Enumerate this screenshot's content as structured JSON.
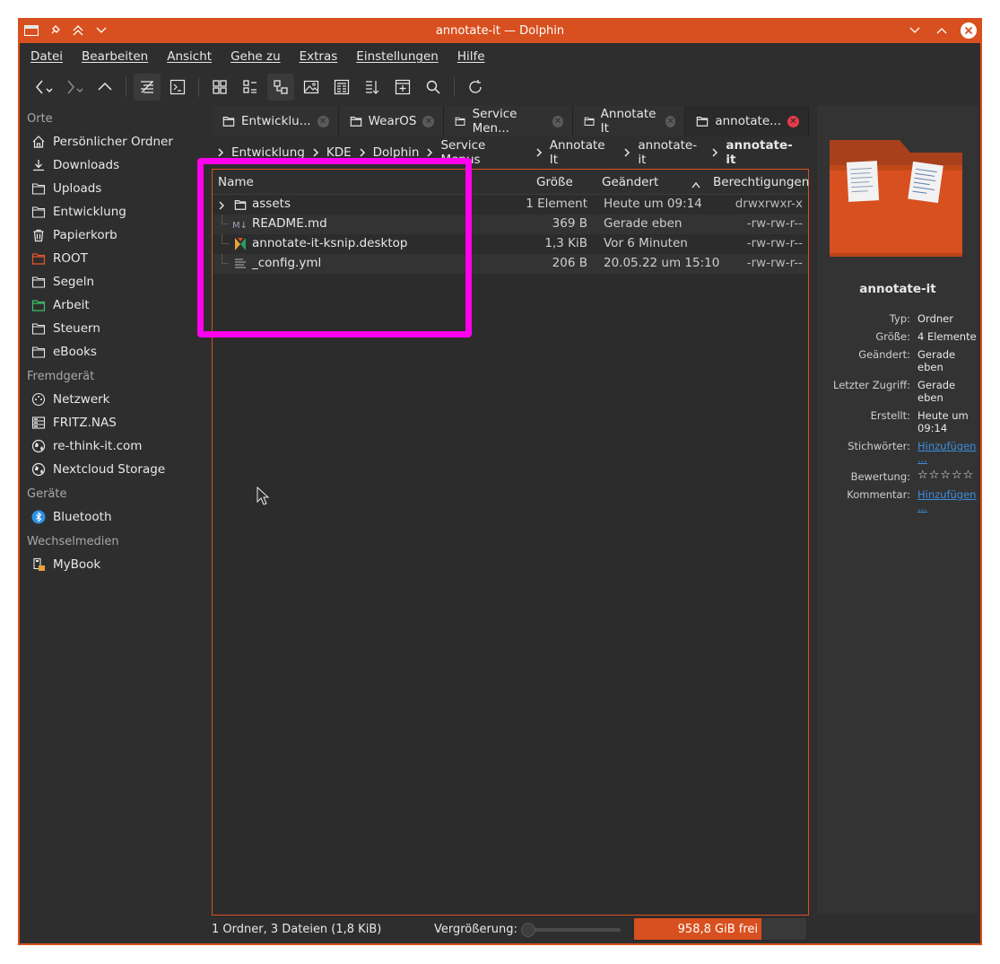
{
  "window": {
    "title": "annotate-it — Dolphin"
  },
  "menu": [
    "Datei",
    "Bearbeiten",
    "Ansicht",
    "Gehe zu",
    "Extras",
    "Einstellungen",
    "Hilfe"
  ],
  "sidebar": {
    "sections": [
      {
        "heading": "Orte",
        "items": [
          {
            "label": "Persönlicher Ordner",
            "icon": "home-icon"
          },
          {
            "label": "Downloads",
            "icon": "download-icon"
          },
          {
            "label": "Uploads",
            "icon": "folder-icon"
          },
          {
            "label": "Entwicklung",
            "icon": "folder-icon"
          },
          {
            "label": "Papierkorb",
            "icon": "trash-icon"
          },
          {
            "label": "ROOT",
            "icon": "folder-red-icon"
          },
          {
            "label": "Segeln",
            "icon": "folder-icon"
          },
          {
            "label": "Arbeit",
            "icon": "folder-green-icon"
          },
          {
            "label": "Steuern",
            "icon": "folder-icon"
          },
          {
            "label": "eBooks",
            "icon": "folder-icon"
          }
        ]
      },
      {
        "heading": "Fremdgerät",
        "items": [
          {
            "label": "Netzwerk",
            "icon": "network-icon"
          },
          {
            "label": "FRITZ.NAS",
            "icon": "nas-icon"
          },
          {
            "label": "re-think-it.com",
            "icon": "globe-icon"
          },
          {
            "label": "Nextcloud Storage",
            "icon": "globe-icon"
          }
        ]
      },
      {
        "heading": "Geräte",
        "items": [
          {
            "label": "Bluetooth",
            "icon": "bluetooth-icon"
          }
        ]
      },
      {
        "heading": "Wechselmedien",
        "items": [
          {
            "label": "MyBook",
            "icon": "usb-drive-icon"
          }
        ]
      }
    ]
  },
  "tabs": [
    {
      "label": "Entwicklu...",
      "active": false
    },
    {
      "label": "WearOS",
      "active": false
    },
    {
      "label": "Service Men...",
      "active": false
    },
    {
      "label": "Annotate It",
      "active": false
    },
    {
      "label": "annotate...",
      "active": true
    }
  ],
  "breadcrumb": [
    "Entwicklung",
    "KDE",
    "Dolphin",
    "Service Menus",
    "Annotate It",
    "annotate-it",
    "annotate-it"
  ],
  "columns": {
    "name": "Name",
    "size": "Größe",
    "modified": "Geändert",
    "permissions": "Berechtigungen"
  },
  "files": [
    {
      "name": "assets",
      "size": "1 Element",
      "modified": "Heute um 09:14",
      "permissions": "drwxrwxr-x",
      "icon": "folder-icon"
    },
    {
      "name": "README.md",
      "size": "369 B",
      "modified": "Gerade eben",
      "permissions": "-rw-rw-r--",
      "icon": "markdown-icon"
    },
    {
      "name": "annotate-it-ksnip.desktop",
      "size": "1,3 KiB",
      "modified": "Vor 6 Minuten",
      "permissions": "-rw-rw-r--",
      "icon": "ksnip-icon"
    },
    {
      "name": "_config.yml",
      "size": "206 B",
      "modified": "20.05.22 um 15:10",
      "permissions": "-rw-rw-r--",
      "icon": "text-file-icon"
    }
  ],
  "info_panel": {
    "title": "annotate-it",
    "rows": [
      {
        "k": "Typ:",
        "v": "Ordner"
      },
      {
        "k": "Größe:",
        "v": "4 Elemente"
      },
      {
        "k": "Geändert:",
        "v": "Gerade eben"
      },
      {
        "k": "Letzter Zugriff:",
        "v": "Gerade eben"
      },
      {
        "k": "Erstellt:",
        "v": "Heute um 09:14"
      },
      {
        "k": "Stichwörter:",
        "v": "Hinzufügen ..."
      },
      {
        "k": "Bewertung:",
        "v": "☆☆☆☆☆"
      },
      {
        "k": "Kommentar:",
        "v": "Hinzufügen ..."
      }
    ],
    "rating": 0
  },
  "status": {
    "summary": "1 Ordner, 3 Dateien (1,8 KiB)",
    "zoom_label": "Vergrößerung:",
    "free_space": "958,8 GiB frei",
    "disk_used_fraction": 0.74
  },
  "colors": {
    "accent": "#d8501f",
    "highlight": "#ff00ee",
    "link": "#3d8fe0"
  }
}
